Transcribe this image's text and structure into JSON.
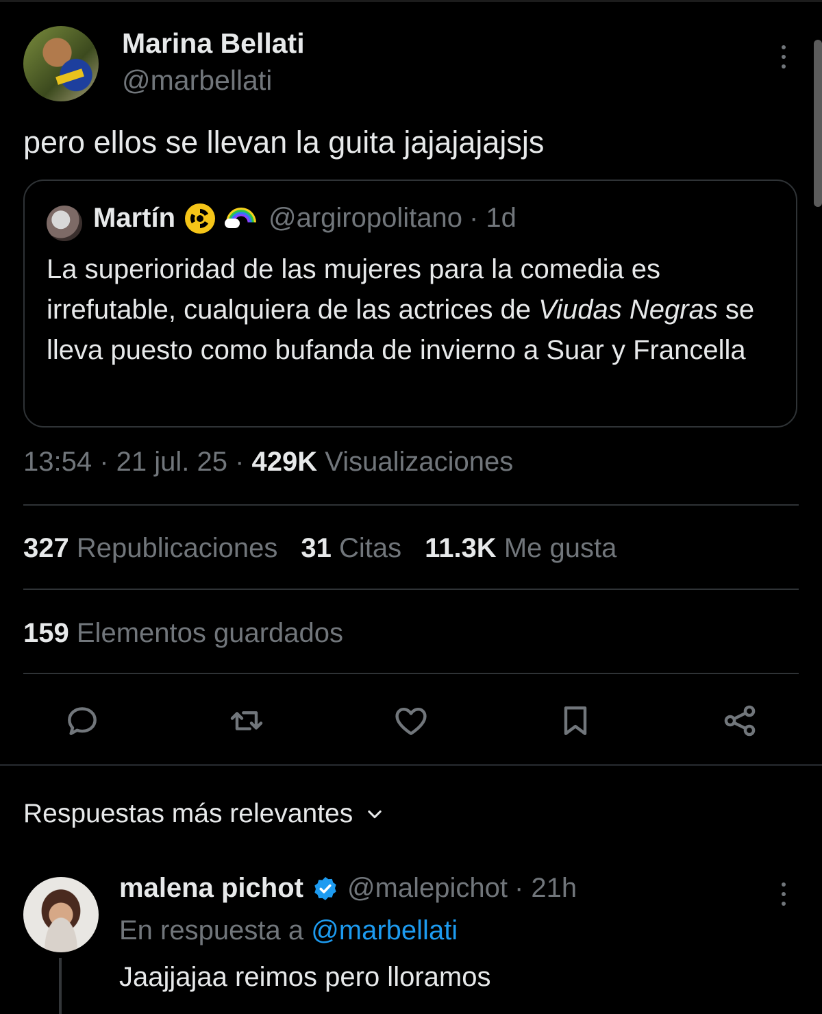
{
  "tweet": {
    "author_name": "Marina Bellati",
    "author_handle": "@marbellati",
    "text": "pero ellos se llevan la guita jajajajajsjs",
    "quoted": {
      "author_name": "Martín",
      "emojis": [
        "radioactive-icon",
        "rainbow-icon"
      ],
      "author_handle": "@argiropolitano",
      "time": "· 1d",
      "text_part1": "La superioridad de las mujeres para la comedia es irrefutable, cualquiera de las actrices de ",
      "text_italic1": "Viudas Negras",
      "text_part2": " se lleva puesto como bufanda de invierno a Suar y Francella"
    },
    "time": "13:54",
    "date": "21 jul. 25",
    "views_count": "429K",
    "views_label": "Visualizaciones",
    "reposts_count": "327",
    "reposts_label": "Republicaciones",
    "quotes_count": "31",
    "quotes_label": "Citas",
    "likes_count": "11.3K",
    "likes_label": "Me gusta",
    "bookmarks_count": "159",
    "bookmarks_label": "Elementos guardados"
  },
  "replies": {
    "sort_label": "Respuestas más relevantes",
    "items": [
      {
        "author_name": "malena pichot",
        "verified": true,
        "author_handle": "@malepichot",
        "time": "· 21h",
        "reply_to_prefix": "En respuesta a",
        "reply_to_handle": "@marbellati",
        "text": "Jaajjajaa reimos pero lloramos"
      }
    ]
  },
  "colors": {
    "background": "#000000",
    "text": "#e7e9ea",
    "secondary": "#71767b",
    "accent": "#1d9bf0",
    "border": "#2f3336"
  }
}
